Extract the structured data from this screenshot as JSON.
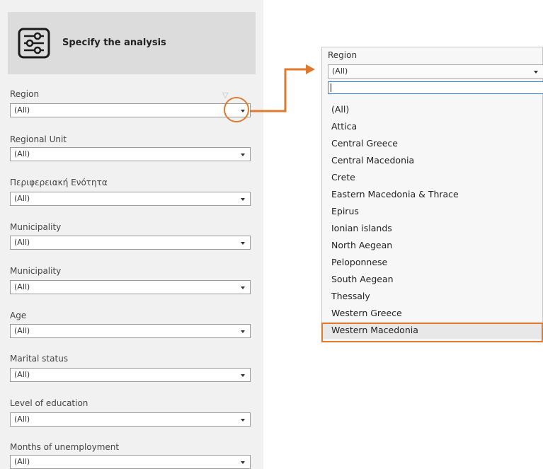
{
  "panel": {
    "title": "Specify the analysis",
    "filters": [
      {
        "label": "Region",
        "value": "(All)"
      },
      {
        "label": "Regional Unit",
        "value": "(All)"
      },
      {
        "label": "Περιφερειακή Ενότητα",
        "value": "(All)"
      },
      {
        "label": "Municipality",
        "value": "(All)"
      },
      {
        "label": "Municipality",
        "value": "(All)"
      },
      {
        "label": "Age",
        "value": "(All)"
      },
      {
        "label": "Marital status",
        "value": "(All)"
      },
      {
        "label": "Level of education",
        "value": "(All)"
      },
      {
        "label": "Months of unemployment",
        "value": "(All)"
      }
    ]
  },
  "dropdown": {
    "label": "Region",
    "selected_value": "(All)",
    "search_value": "",
    "options": [
      "(All)",
      "Attica",
      "Central Greece",
      "Central Macedonia",
      "Crete",
      "Eastern Macedonia & Thrace",
      "Epirus",
      "Ionian islands",
      "North Aegean",
      "Peloponnese",
      "South Aegean",
      "Thessaly",
      "Western Greece",
      "Western Macedonia"
    ],
    "highlighted_option": "Western Macedonia"
  },
  "icons": {
    "header": "sliders-icon",
    "funnel": "filter-funnel-icon",
    "arrow": "chevron-down-icon"
  },
  "colors": {
    "accent": "#e07a2e",
    "panel_bg": "#f1f1f1",
    "header_bg": "#dcdcdc",
    "search_border": "#3d7dd0"
  }
}
